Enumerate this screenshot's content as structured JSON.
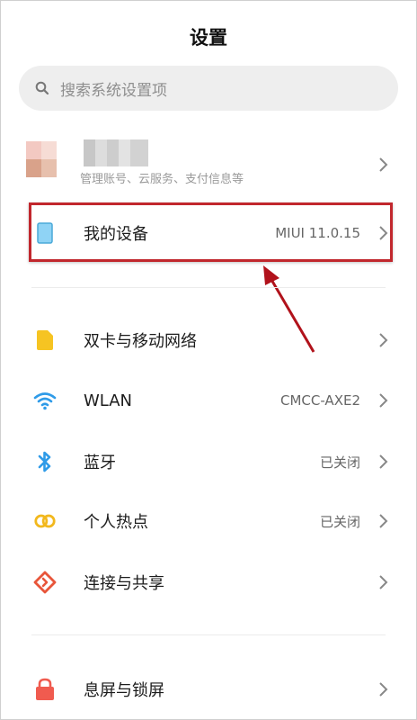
{
  "header": {
    "title": "设置"
  },
  "search": {
    "placeholder": "搜索系统设置项"
  },
  "account": {
    "subtitle": "管理账号、云服务、支付信息等"
  },
  "my_device": {
    "label": "我的设备",
    "value": "MIUI 11.0.15"
  },
  "items": [
    {
      "label": "双卡与移动网络",
      "value": ""
    },
    {
      "label": "WLAN",
      "value": "CMCC-AXE2"
    },
    {
      "label": "蓝牙",
      "value": "已关闭"
    },
    {
      "label": "个人热点",
      "value": "已关闭"
    },
    {
      "label": "连接与共享",
      "value": ""
    },
    {
      "label": "息屏与锁屏",
      "value": ""
    }
  ],
  "colors": {
    "sim_icon": "#f6c422",
    "wifi_icon": "#2f9be8",
    "bluetooth_icon": "#2f9be8",
    "hotspot_icon": "#f2b81d",
    "share_icon": "#e8553a",
    "lock_icon": "#f05b4f",
    "device_icon": "#6fc7f2",
    "highlight": "#c1272d"
  }
}
